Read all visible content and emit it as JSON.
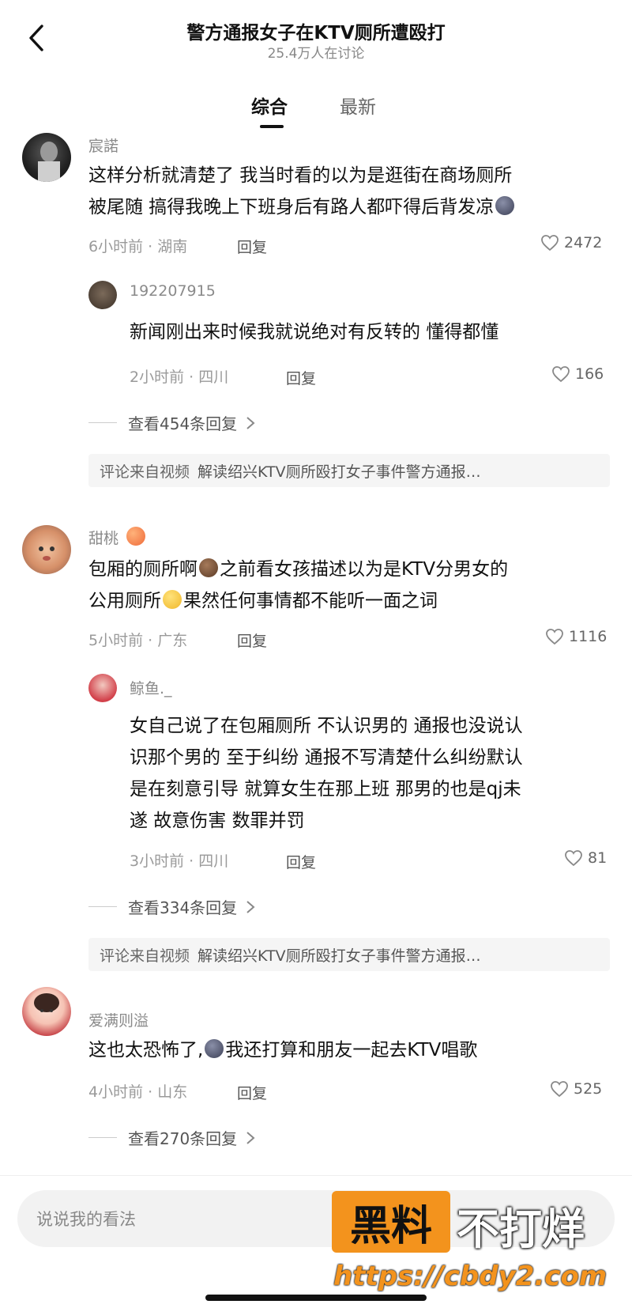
{
  "header": {
    "title": "警方通报女子在KTV厕所遭殴打",
    "subtitle": "25.4万人在讨论"
  },
  "tabs": [
    {
      "label": "综合",
      "active": true
    },
    {
      "label": "最新",
      "active": false
    }
  ],
  "comments": [
    {
      "username": "宸諾",
      "text_lines": [
        "这样分析就清楚了 我当时看的以为是逛街在商场厕所",
        "被尾随 搞得我晚上下班身后有路人都吓得后背发凉"
      ],
      "meta": "6小时前 · 湖南",
      "reply_label": "回复",
      "likes": "2472",
      "reply": {
        "username": "192207915",
        "text_lines": [
          "新闻刚出来时候我就说绝对有反转的  懂得都懂"
        ],
        "meta": "2小时前 · 四川",
        "reply_label": "回复",
        "likes": "166"
      },
      "view_more": "查看454条回复",
      "from_video_label": "评论来自视频",
      "from_video_title": "解读绍兴KTV厕所殴打女子事件警方通报…"
    },
    {
      "username": "甜桃",
      "text_lines": [
        "包厢的厕所啊",
        "之前看女孩描述以为是KTV分男女的",
        "公用厕所",
        "果然任何事情都不能听一面之词"
      ],
      "meta": "5小时前 · 广东",
      "reply_label": "回复",
      "likes": "1116",
      "reply": {
        "username": "鲸鱼._",
        "text_lines": [
          "女自己说了在包厢厕所 不认识男的 通报也没说认",
          "识那个男的 至于纠纷 通报不写清楚什么纠纷默认",
          "是在刻意引导 就算女生在那上班 那男的也是qj未",
          "遂 故意伤害 数罪并罚"
        ],
        "meta": "3小时前 · 四川",
        "reply_label": "回复",
        "likes": "81"
      },
      "view_more": "查看334条回复",
      "from_video_label": "评论来自视频",
      "from_video_title": "解读绍兴KTV厕所殴打女子事件警方通报…"
    },
    {
      "username": "爱满则溢",
      "text_lines": [
        "这也太恐怖了,",
        "我还打算和朋友一起去KTV唱歌"
      ],
      "meta": "4小时前 · 山东",
      "reply_label": "回复",
      "likes": "525",
      "view_more": "查看270条回复"
    }
  ],
  "input": {
    "placeholder": "说说我的看法"
  },
  "watermark": {
    "box_text": "黑料",
    "text": "不打烊",
    "url": "https://cbdy2.com"
  }
}
